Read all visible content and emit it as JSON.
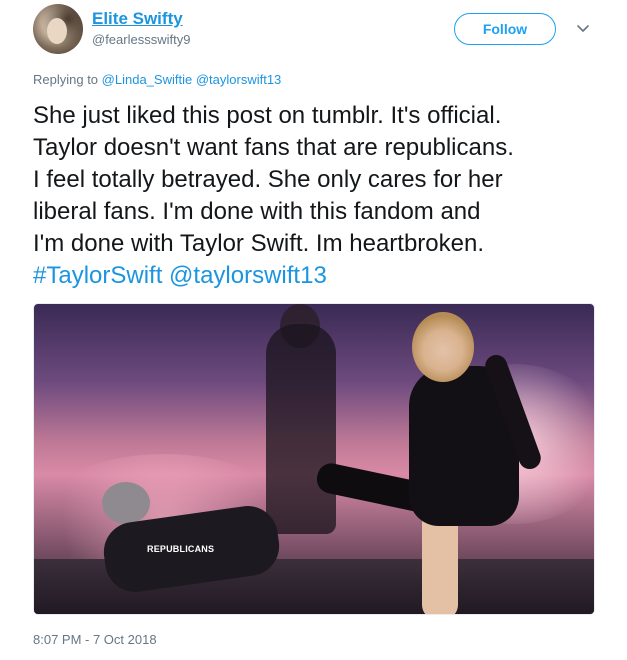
{
  "user": {
    "display_name": "Elite Swifty",
    "screen_name": "@fearlessswifty9"
  },
  "follow_button": {
    "label": "Follow"
  },
  "reply": {
    "prefix": "Replying to",
    "mentions": [
      "@Linda_Swiftie",
      "@taylorswift13"
    ]
  },
  "tweet": {
    "lines": [
      "She just liked this post on tumblr. It's official.",
      "Taylor doesn't want fans that are republicans.",
      "I feel totally betrayed. She only cares for her",
      "liberal fans. I'm done with this fandom and",
      "I'm done with Taylor Swift. Im heartbroken."
    ],
    "hashtag": "#TaylorSwift",
    "mention": "@taylorswift13"
  },
  "media": {
    "overlay_label": "REPUBLICANS"
  },
  "timestamp": "8:07 PM - 7 Oct 2018",
  "colors": {
    "link": "#1b95e0",
    "button_border": "#1da1f2",
    "secondary_text": "#657786",
    "primary_text": "#14171a"
  },
  "icons": [
    "avatar",
    "chevron-down-icon"
  ]
}
